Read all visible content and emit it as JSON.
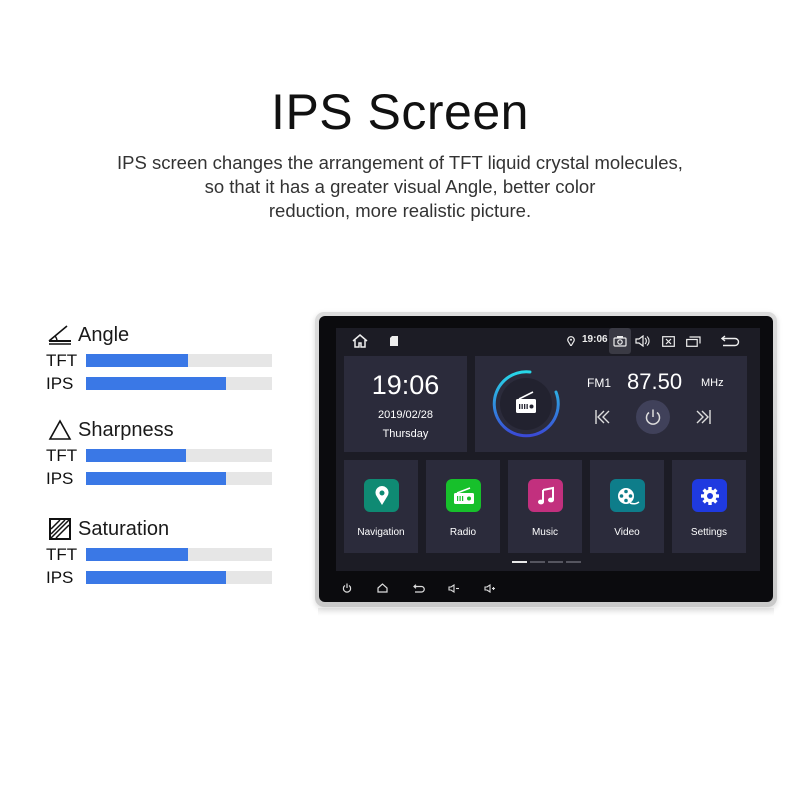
{
  "header": {
    "title": "IPS Screen",
    "subtitle_lines": [
      "IPS screen changes the arrangement of TFT liquid crystal molecules,",
      "so that it has a greater visual Angle, better color",
      "reduction, more realistic picture."
    ]
  },
  "comparison": {
    "accent_color": "#3a78e6",
    "track_color": "#e6e6e6",
    "metrics": [
      {
        "label": "Angle",
        "icon": "angle-icon",
        "bars": [
          {
            "label": "TFT",
            "value_percent": 55
          },
          {
            "label": "IPS",
            "value_percent": 75
          }
        ]
      },
      {
        "label": "Sharpness",
        "icon": "triangle-icon",
        "bars": [
          {
            "label": "TFT",
            "value_percent": 54
          },
          {
            "label": "IPS",
            "value_percent": 75
          }
        ]
      },
      {
        "label": "Saturation",
        "icon": "hatched-square-icon",
        "bars": [
          {
            "label": "TFT",
            "value_percent": 55
          },
          {
            "label": "IPS",
            "value_percent": 75
          }
        ]
      }
    ]
  },
  "device": {
    "statusbar": {
      "time": "19:06",
      "icons": [
        "home-icon",
        "sd-card-icon",
        "location-icon",
        "camera-icon",
        "volume-icon",
        "close-box-icon",
        "recent-apps-icon",
        "back-icon"
      ]
    },
    "clock": {
      "time": "19:06",
      "date": "2019/02/28",
      "day": "Thursday"
    },
    "radio": {
      "band": "FM1",
      "frequency": "87.50",
      "unit": "MHz"
    },
    "apps": [
      {
        "name": "Navigation",
        "icon": "map-pin-icon",
        "color": "#0f8a73"
      },
      {
        "name": "Radio",
        "icon": "radio-icon",
        "color": "#17c02b"
      },
      {
        "name": "Music",
        "icon": "music-note-icon",
        "color": "#c2307e"
      },
      {
        "name": "Video",
        "icon": "film-reel-icon",
        "color": "#0e7d8a"
      },
      {
        "name": "Settings",
        "icon": "gear-icon",
        "color": "#1f3ae0"
      }
    ],
    "pager": {
      "pages": 4,
      "current": 1
    },
    "hardware_buttons": [
      "power-icon",
      "home-icon",
      "back-icon",
      "volume-down-icon",
      "volume-up-icon"
    ]
  }
}
